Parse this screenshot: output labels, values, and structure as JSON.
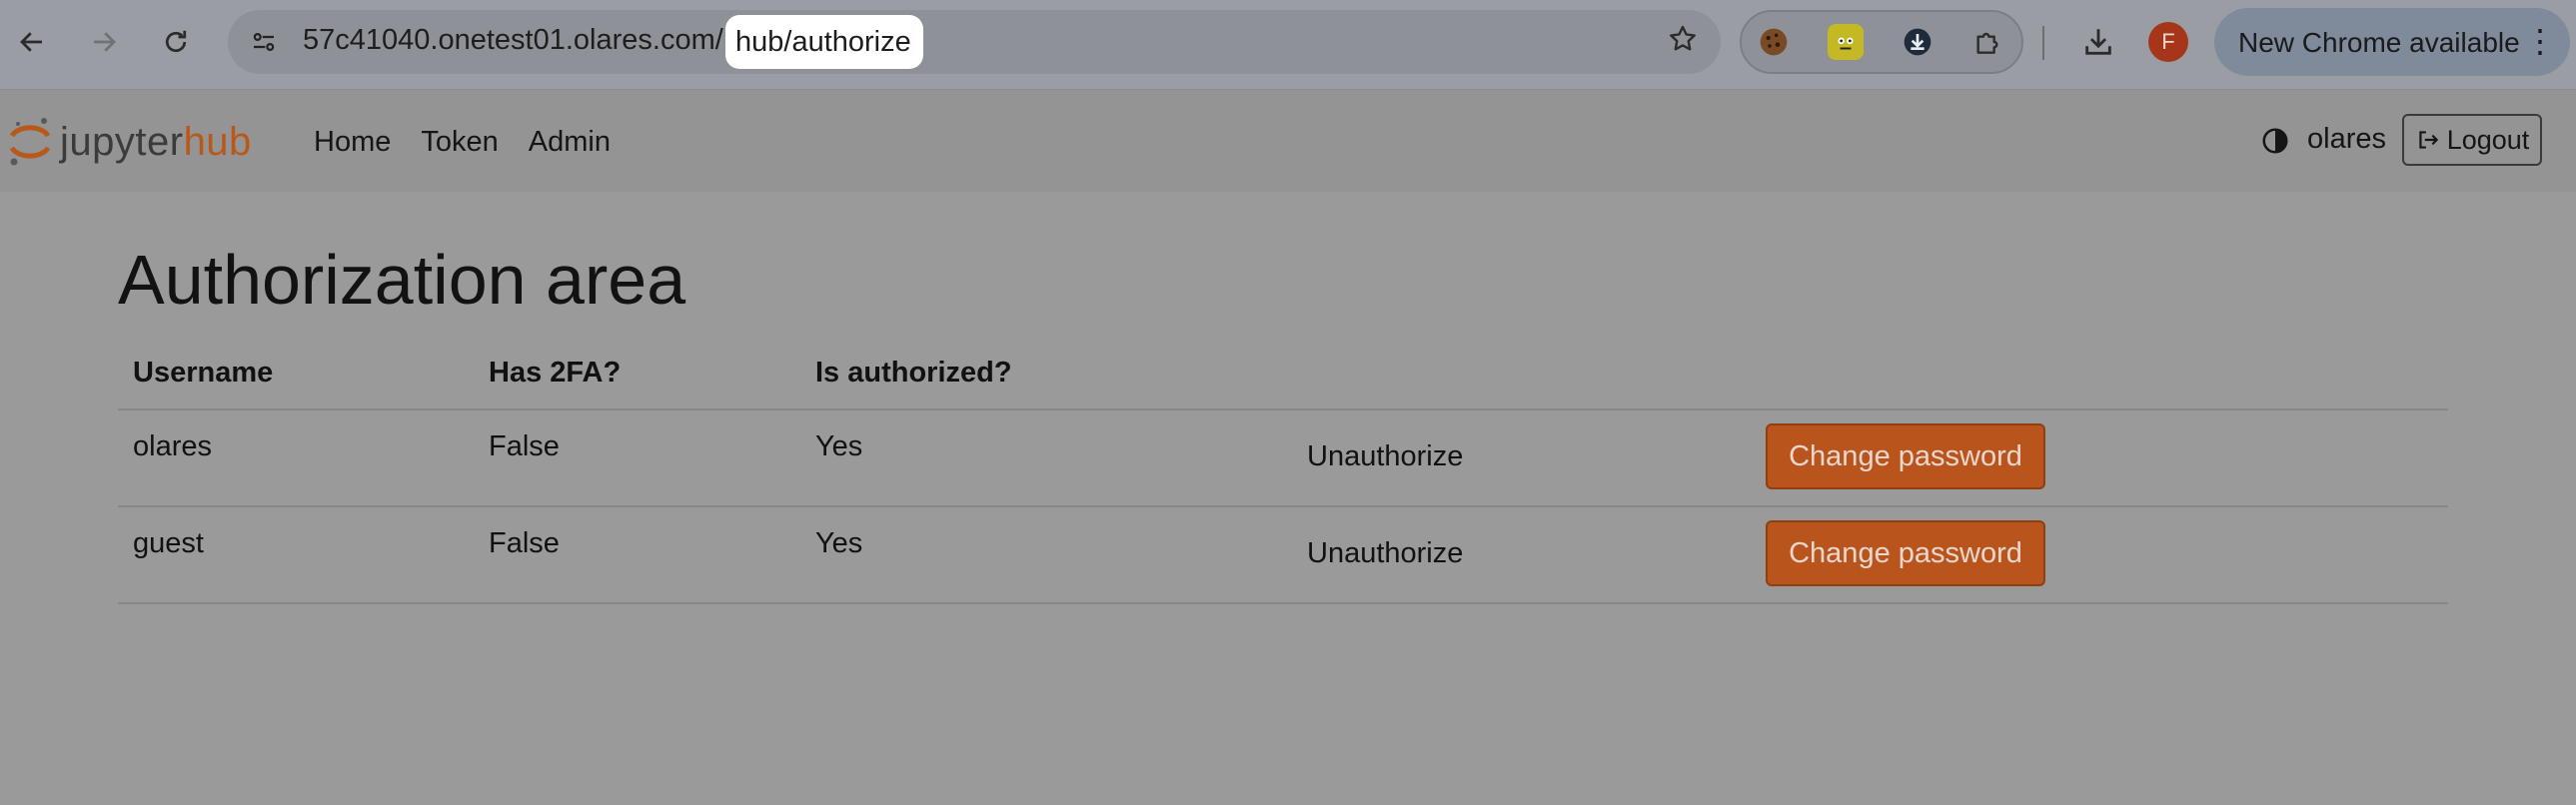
{
  "browser": {
    "url_host": "57c41040.onetest01.olares.com/",
    "url_path": "hub/authorize",
    "profile_initial": "F",
    "update_label": "New Chrome available"
  },
  "hub_nav": {
    "logo_part1": "jupyter",
    "logo_part2": "hub",
    "links": [
      "Home",
      "Token",
      "Admin"
    ],
    "username": "olares",
    "logout_label": "Logout"
  },
  "main": {
    "title": "Authorization area",
    "table": {
      "headers": [
        "Username",
        "Has 2FA?",
        "Is authorized?"
      ],
      "rows": [
        {
          "username": "olares",
          "has_2fa": "False",
          "is_authorized": "Yes",
          "unauthorize_label": "Unauthorize",
          "change_password_label": "Change password"
        },
        {
          "username": "guest",
          "has_2fa": "False",
          "is_authorized": "Yes",
          "unauthorize_label": "Unauthorize",
          "change_password_label": "Change password"
        }
      ]
    }
  },
  "colors": {
    "overlay_bg": "#9a9a9a",
    "accent_orange": "#b9541d",
    "avatar_red": "#a5361a",
    "url_highlight": "#ffffff"
  }
}
